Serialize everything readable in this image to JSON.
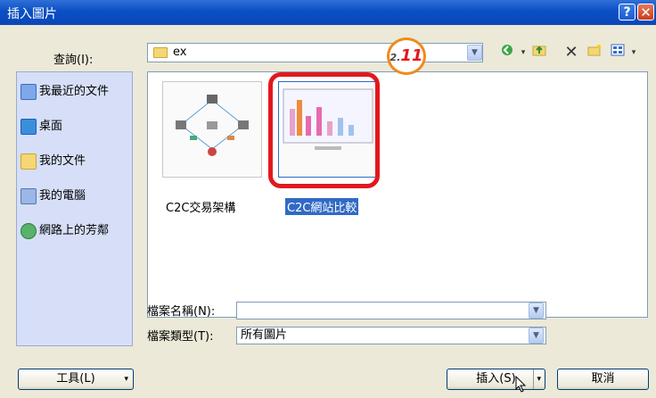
{
  "window": {
    "title": "插入圖片"
  },
  "toolbar": {
    "lookin_label": "查詢(I):",
    "lookin_value": "ex"
  },
  "places": [
    {
      "label": "我最近的文件",
      "icon": "recent-documents-icon"
    },
    {
      "label": "桌面",
      "icon": "desktop-icon"
    },
    {
      "label": "我的文件",
      "icon": "my-documents-icon"
    },
    {
      "label": "我的電腦",
      "icon": "my-computer-icon"
    },
    {
      "label": "網路上的芳鄰",
      "icon": "network-places-icon"
    }
  ],
  "files": [
    {
      "name": "C2C交易架構",
      "selected": false
    },
    {
      "name": "C2C網站比較",
      "selected": true
    }
  ],
  "callout": {
    "prefix": "2.",
    "number": "11",
    "color": "#e2181f"
  },
  "form": {
    "filename_label": "檔案名稱(N):",
    "filename_value": "",
    "filetype_label": "檔案類型(T):",
    "filetype_value": "所有圖片"
  },
  "buttons": {
    "tools": "工具(L)",
    "insert": "插入(S)",
    "cancel": "取消"
  },
  "colors": {
    "titlebar": "#0b4fc4",
    "selection": "#316ac5",
    "highlight": "#e2181f"
  }
}
